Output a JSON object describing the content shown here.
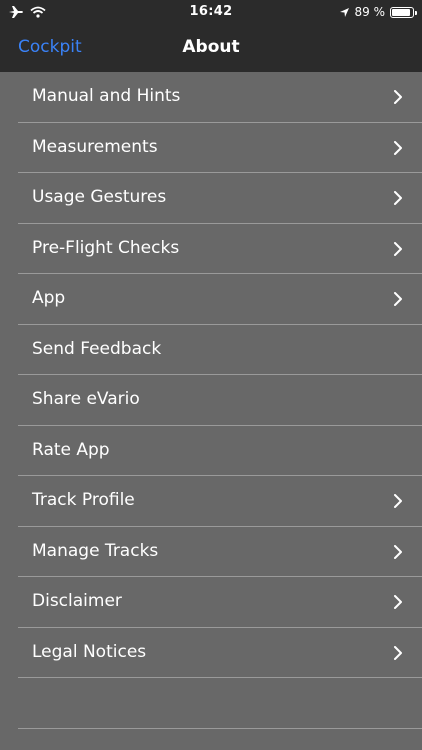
{
  "status_bar": {
    "time": "16:42",
    "battery": "89 %",
    "battery_level": 0.89,
    "icons": [
      "airplane-icon",
      "wifi-icon",
      "location-arrow-icon",
      "battery-icon"
    ]
  },
  "nav": {
    "back_label": "Cockpit",
    "title": "About"
  },
  "menu": {
    "items": [
      {
        "label": "Manual and Hints",
        "chevron": true
      },
      {
        "label": "Measurements",
        "chevron": true
      },
      {
        "label": "Usage Gestures",
        "chevron": true
      },
      {
        "label": "Pre-Flight Checks",
        "chevron": true
      },
      {
        "label": "App",
        "chevron": true
      },
      {
        "label": "Send Feedback",
        "chevron": false
      },
      {
        "label": "Share eVario",
        "chevron": false
      },
      {
        "label": "Rate App",
        "chevron": false
      },
      {
        "label": "Track Profile",
        "chevron": true
      },
      {
        "label": "Manage Tracks",
        "chevron": true
      },
      {
        "label": "Disclaimer",
        "chevron": true
      },
      {
        "label": "Legal Notices",
        "chevron": true
      }
    ]
  },
  "colors": {
    "bar_background": "#2b2b2b",
    "list_background": "#686868",
    "separator": "#9a9a9a",
    "accent": "#3a82f7",
    "text": "#ffffff"
  }
}
